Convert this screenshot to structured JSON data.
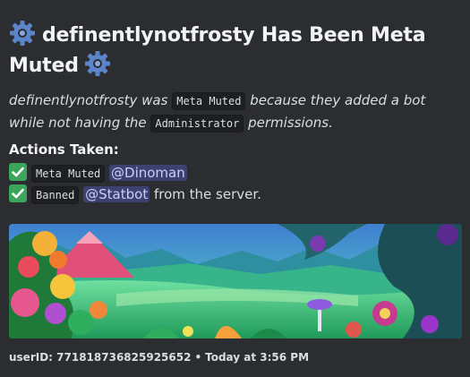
{
  "embed": {
    "title": "definentlynotfrosty Has Been Meta Muted",
    "title_icon": "gear-icon",
    "description": {
      "user": "definentlynotfrosty",
      "was": "was",
      "action_code": "Meta Muted",
      "because": "because they added a bot while not having the",
      "permission_code": "Administrator",
      "permissions": "permissions."
    },
    "actions_title": "Actions Taken:",
    "actions": [
      {
        "code": "Meta Muted",
        "mention": "@Dinoman",
        "suffix": ""
      },
      {
        "code": "Banned",
        "mention": "@Statbot",
        "suffix": "from the server."
      }
    ],
    "banner_image": "fantasy-jungle-landscape-illustration",
    "footer": {
      "user_id": "userID: 771818736825925652",
      "separator": "•",
      "timestamp": "Today at 3:56 PM"
    }
  },
  "colors": {
    "background": "#2b2d31",
    "check": "#3ba55c",
    "mention_bg": "#3c4270",
    "mention_fg": "#c9cdfb",
    "gear": "#5a7fc2"
  }
}
